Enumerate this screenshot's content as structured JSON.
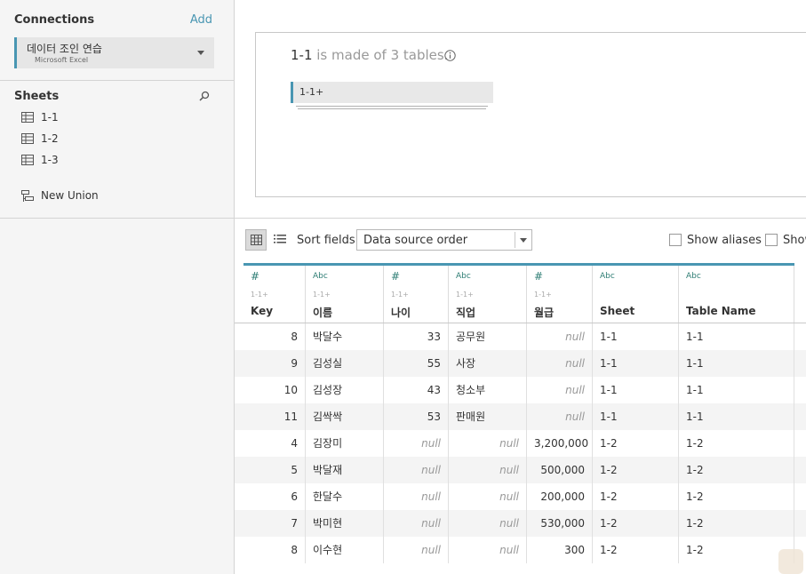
{
  "connections": {
    "title": "Connections",
    "add_label": "Add",
    "source_name": "데이터 조인 연습",
    "source_type": "Microsoft Excel"
  },
  "sheets": {
    "title": "Sheets",
    "items": [
      {
        "label": "1-1"
      },
      {
        "label": "1-2"
      },
      {
        "label": "1-3"
      }
    ],
    "new_union_label": "New Union"
  },
  "canvas": {
    "table_name": "1-1",
    "title_rest": " is made of 3 tables.",
    "chip_label": "1-1+"
  },
  "toolbar": {
    "sort_label": "Sort fields",
    "sort_value": "Data source order",
    "show_aliases_label": "Show aliases",
    "show_hidden_label": "Show"
  },
  "grid": {
    "columns": [
      {
        "type": "#",
        "source": "1-1+",
        "name": "Key"
      },
      {
        "type": "Abc",
        "source": "1-1+",
        "name": "이름"
      },
      {
        "type": "#",
        "source": "1-1+",
        "name": "나이"
      },
      {
        "type": "Abc",
        "source": "1-1+",
        "name": "직업"
      },
      {
        "type": "#",
        "source": "1-1+",
        "name": "월급"
      },
      {
        "type": "Abc",
        "source": "",
        "name": "Sheet"
      },
      {
        "type": "Abc",
        "source": "",
        "name": "Table Name"
      }
    ],
    "rows": [
      [
        "8",
        "박달수",
        "33",
        "공무원",
        "null",
        "1-1",
        "1-1"
      ],
      [
        "9",
        "김성실",
        "55",
        "사장",
        "null",
        "1-1",
        "1-1"
      ],
      [
        "10",
        "김성장",
        "43",
        "청소부",
        "null",
        "1-1",
        "1-1"
      ],
      [
        "11",
        "김싹싹",
        "53",
        "판매원",
        "null",
        "1-1",
        "1-1"
      ],
      [
        "4",
        "김장미",
        "null",
        "null",
        "3,200,000",
        "1-2",
        "1-2"
      ],
      [
        "5",
        "박달재",
        "null",
        "null",
        "500,000",
        "1-2",
        "1-2"
      ],
      [
        "6",
        "한달수",
        "null",
        "null",
        "200,000",
        "1-2",
        "1-2"
      ],
      [
        "7",
        "박미현",
        "null",
        "null",
        "530,000",
        "1-2",
        "1-2"
      ],
      [
        "8",
        "이수현",
        "null",
        "null",
        "300",
        "1-2",
        "1-2"
      ]
    ]
  }
}
